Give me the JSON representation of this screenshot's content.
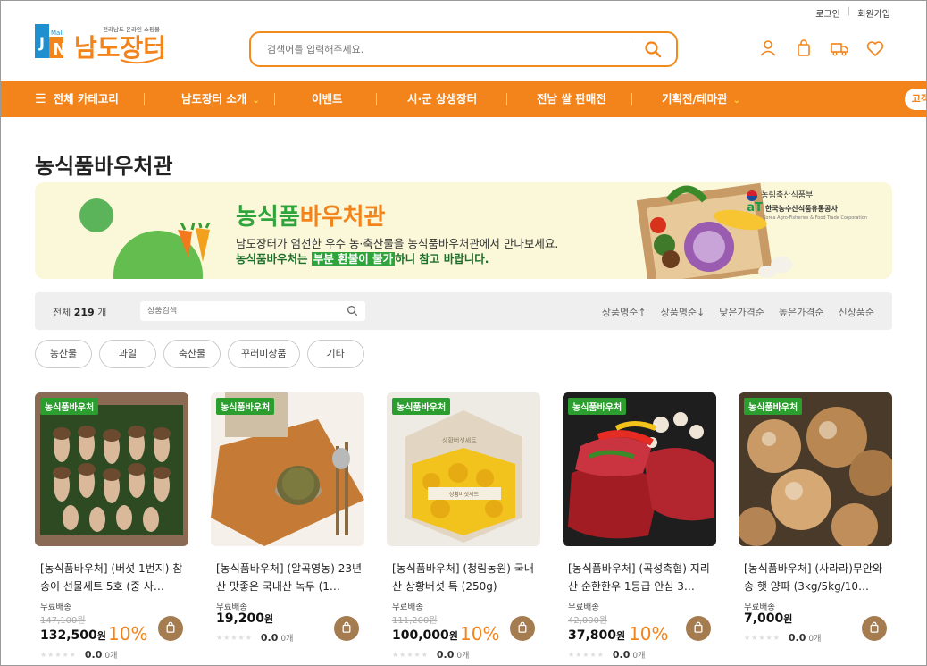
{
  "util": {
    "login": "로그인",
    "join": "회원가입"
  },
  "logo": {
    "mall": "Mall",
    "brand": "남도장터",
    "tagline": "전라남도 온라인 쇼핑몰"
  },
  "search": {
    "placeholder": "검색어를 입력해주세요."
  },
  "nav": {
    "all_category": "전체 카테고리",
    "items": [
      "남도장터 소개",
      "이벤트",
      "시·군 상생장터",
      "전남 쌀 판매전",
      "기획전/테마관"
    ],
    "cs": "고객"
  },
  "page_title": "농식품바우처관",
  "banner": {
    "title_green": "농식품",
    "title_orange": "바우처관",
    "line1": "남도장터가 엄선한 우수 농·축산물을 농식품바우처관에서 만나보세요.",
    "line2_pre": "농식품바우처는 ",
    "line2_hl": "부분 환불이 불가",
    "line2_post": "하니 참고 바랍니다.",
    "ministry": "농림축산식품부",
    "at_label": "aT",
    "at_name": "한국농수산식품유통공사",
    "at_eng": "Korea Agro-Fisheries & Food Trade Corporation"
  },
  "filter": {
    "total_label": "전체",
    "total_count": "219",
    "total_unit": "개",
    "search_placeholder": "상품검색",
    "sorts": [
      "상품명순↑",
      "상품명순↓",
      "낮은가격순",
      "높은가격순",
      "신상품순"
    ]
  },
  "chips": [
    "농산물",
    "과일",
    "축산물",
    "꾸러미상품",
    "기타"
  ],
  "products": [
    {
      "tag": "농식품바우처",
      "name": "[농식품바우처] (버섯 1번지) 참송이 선물세트 5호 (중 사…",
      "shipping": "무료배송",
      "original_price": "147,100원",
      "price": "132,500",
      "won": "원",
      "discount": "10%",
      "rating": "0.0",
      "reviews": "0개"
    },
    {
      "tag": "농식품바우처",
      "name": "[농식품바우처] (알곡영농) 23년산 맛좋은 국내산 녹두 (1…",
      "shipping": "무료배송",
      "original_price": "",
      "price": "19,200",
      "won": "원",
      "discount": "",
      "rating": "0.0",
      "reviews": "0개"
    },
    {
      "tag": "농식품바우처",
      "name": "[농식품바우처] (청림농원) 국내산 상황버섯 특 (250g)",
      "shipping": "무료배송",
      "original_price": "111,200원",
      "price": "100,000",
      "won": "원",
      "discount": "10%",
      "rating": "0.0",
      "reviews": "0개"
    },
    {
      "tag": "농식품바우처",
      "name": "[농식품바우처] (곡성축협) 지리산 순한한우 1등급 안심 3…",
      "shipping": "무료배송",
      "original_price": "42,000원",
      "price": "37,800",
      "won": "원",
      "discount": "10%",
      "rating": "0.0",
      "reviews": "0개"
    },
    {
      "tag": "농식품바우처",
      "name": "[농식품바우처] (사라라)무안와송 햇 양파 (3kg/5kg/10…",
      "shipping": "무료배송",
      "original_price": "",
      "price": "7,000",
      "won": "원",
      "discount": "",
      "rating": "0.0",
      "reviews": "0개"
    }
  ],
  "colors": {
    "brand_orange": "#f3841b",
    "voucher_green": "#2c9d2f",
    "cart_brown": "#a47c50"
  }
}
